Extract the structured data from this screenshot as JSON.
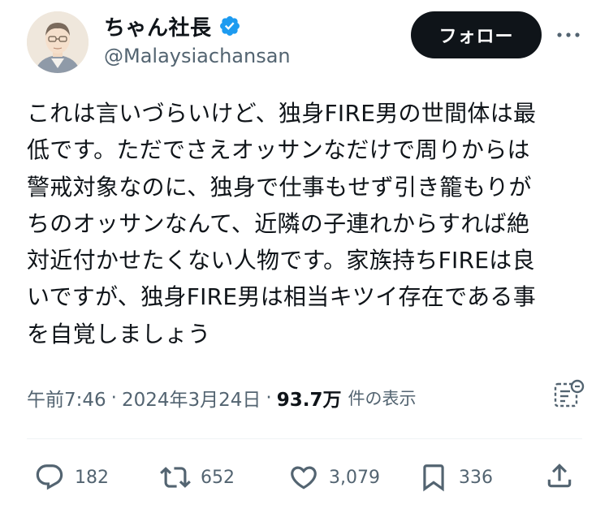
{
  "author": {
    "display_name": "ちゃん社長",
    "handle": "@Malaysiachansan",
    "verified": true,
    "verified_color": "#1d9bf0"
  },
  "follow_button": {
    "label": "フォロー"
  },
  "tweet": {
    "lines": [
      "これは言いづらいけど、独身FIRE男の世間体は最",
      "低です。ただでさえオッサンなだけで周りからは",
      "警戒対象なのに、独身で仕事もせず引き籠もりが",
      "ちのオッサンなんて、近隣の子連れからすれば絶",
      "対近付かせたくない人物です。家族持ちFIREは良",
      "いですが、独身FIRE男は相当キツイ存在である事",
      "を自覚しましょう"
    ]
  },
  "meta": {
    "time": "午前7:46",
    "separator": "·",
    "date": "2024年3月24日",
    "views": "93.7万",
    "views_label": "件の表示"
  },
  "actions": {
    "replies": "182",
    "retweets": "652",
    "likes": "3,079",
    "bookmarks": "336"
  },
  "icons": {
    "more": "more-icon",
    "analytics": "analytics-icon",
    "reply": "reply-icon",
    "retweet": "retweet-icon",
    "like": "heart-icon",
    "bookmark": "bookmark-icon",
    "share": "share-icon"
  },
  "colors": {
    "text": "#0f1419",
    "secondary": "#536471",
    "follow_bg": "#0f1419",
    "accent": "#1d9bf0"
  }
}
